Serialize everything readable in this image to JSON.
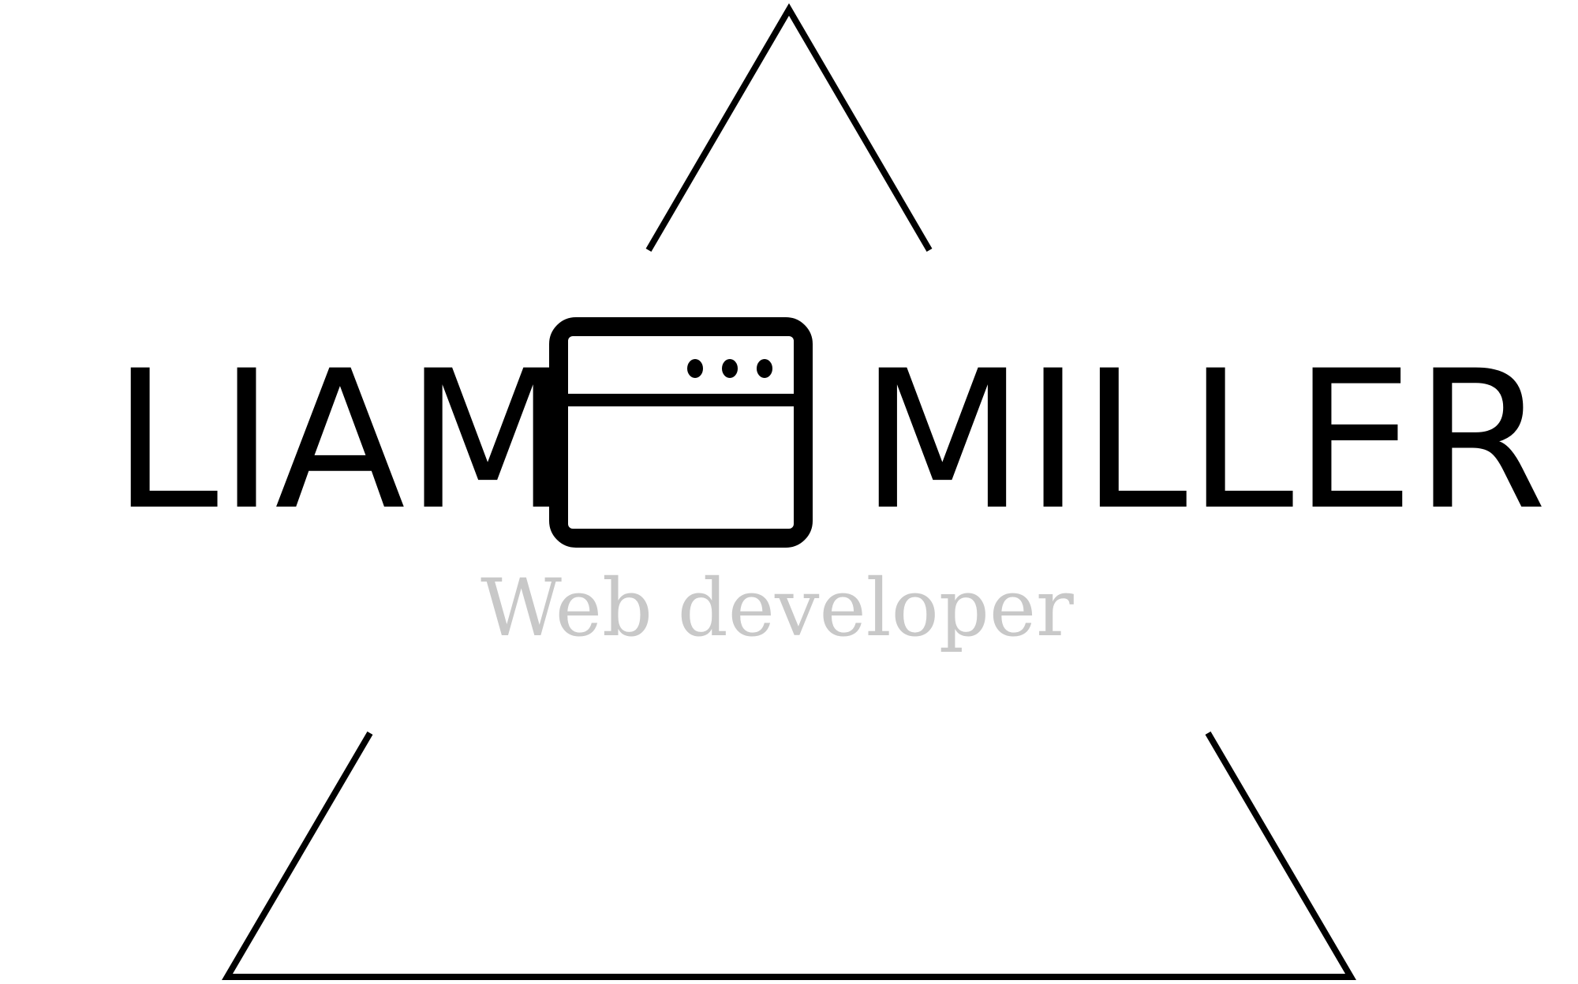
{
  "logo": {
    "first_name": "LIAM",
    "last_name": "MILLER",
    "tagline": "Web developer",
    "emblem_icon": "browser-window-icon",
    "frame_shape": "triangle-outline"
  },
  "colors": {
    "background": "#ffffff",
    "name_text": "#000000",
    "tagline_text": "#c8c8c8",
    "frame_stroke": "#000000"
  }
}
